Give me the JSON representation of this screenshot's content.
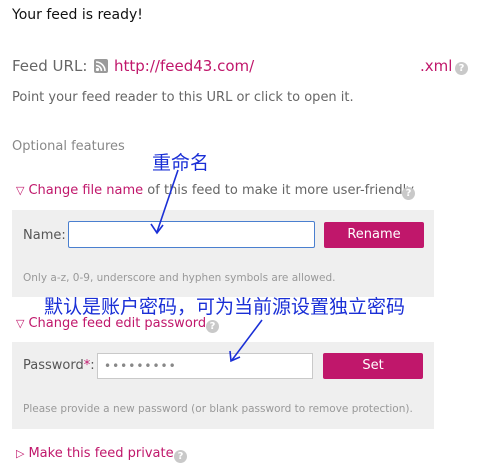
{
  "header": {
    "ready": "Your feed is ready!"
  },
  "feed": {
    "url_label": "Feed URL:",
    "url": "http://feed43.com/",
    "extension": ".xml",
    "point_text": "Point your feed reader to this URL or click to open it."
  },
  "optional": {
    "heading": "Optional features",
    "change_name": {
      "toggle_arrow": "▽",
      "toggle_link": "Change file name",
      "toggle_rest": " of this feed to make it more user-friendly",
      "label": "Name:",
      "value": "",
      "button": "Rename",
      "note": "Only a-z, 0-9, underscore and hyphen symbols are allowed."
    },
    "change_password": {
      "toggle_arrow": "▽",
      "toggle_link": "Change feed edit password",
      "label": "Password",
      "required_mark": "*",
      "label_suffix": ":",
      "value": "•••••••••",
      "button": "Set",
      "note": "Please provide a new password (or blank password to remove protection)."
    },
    "make_private": {
      "toggle_arrow": "▷",
      "toggle_link": "Make this feed private"
    }
  },
  "help_glyph": "?",
  "annotations": {
    "name_note": "重命名",
    "password_note": "默认是账户密码，可为当前源设置独立密码",
    "color": "#1a2fd6"
  },
  "colors": {
    "accent": "#c0176b",
    "panel": "#efefef"
  }
}
